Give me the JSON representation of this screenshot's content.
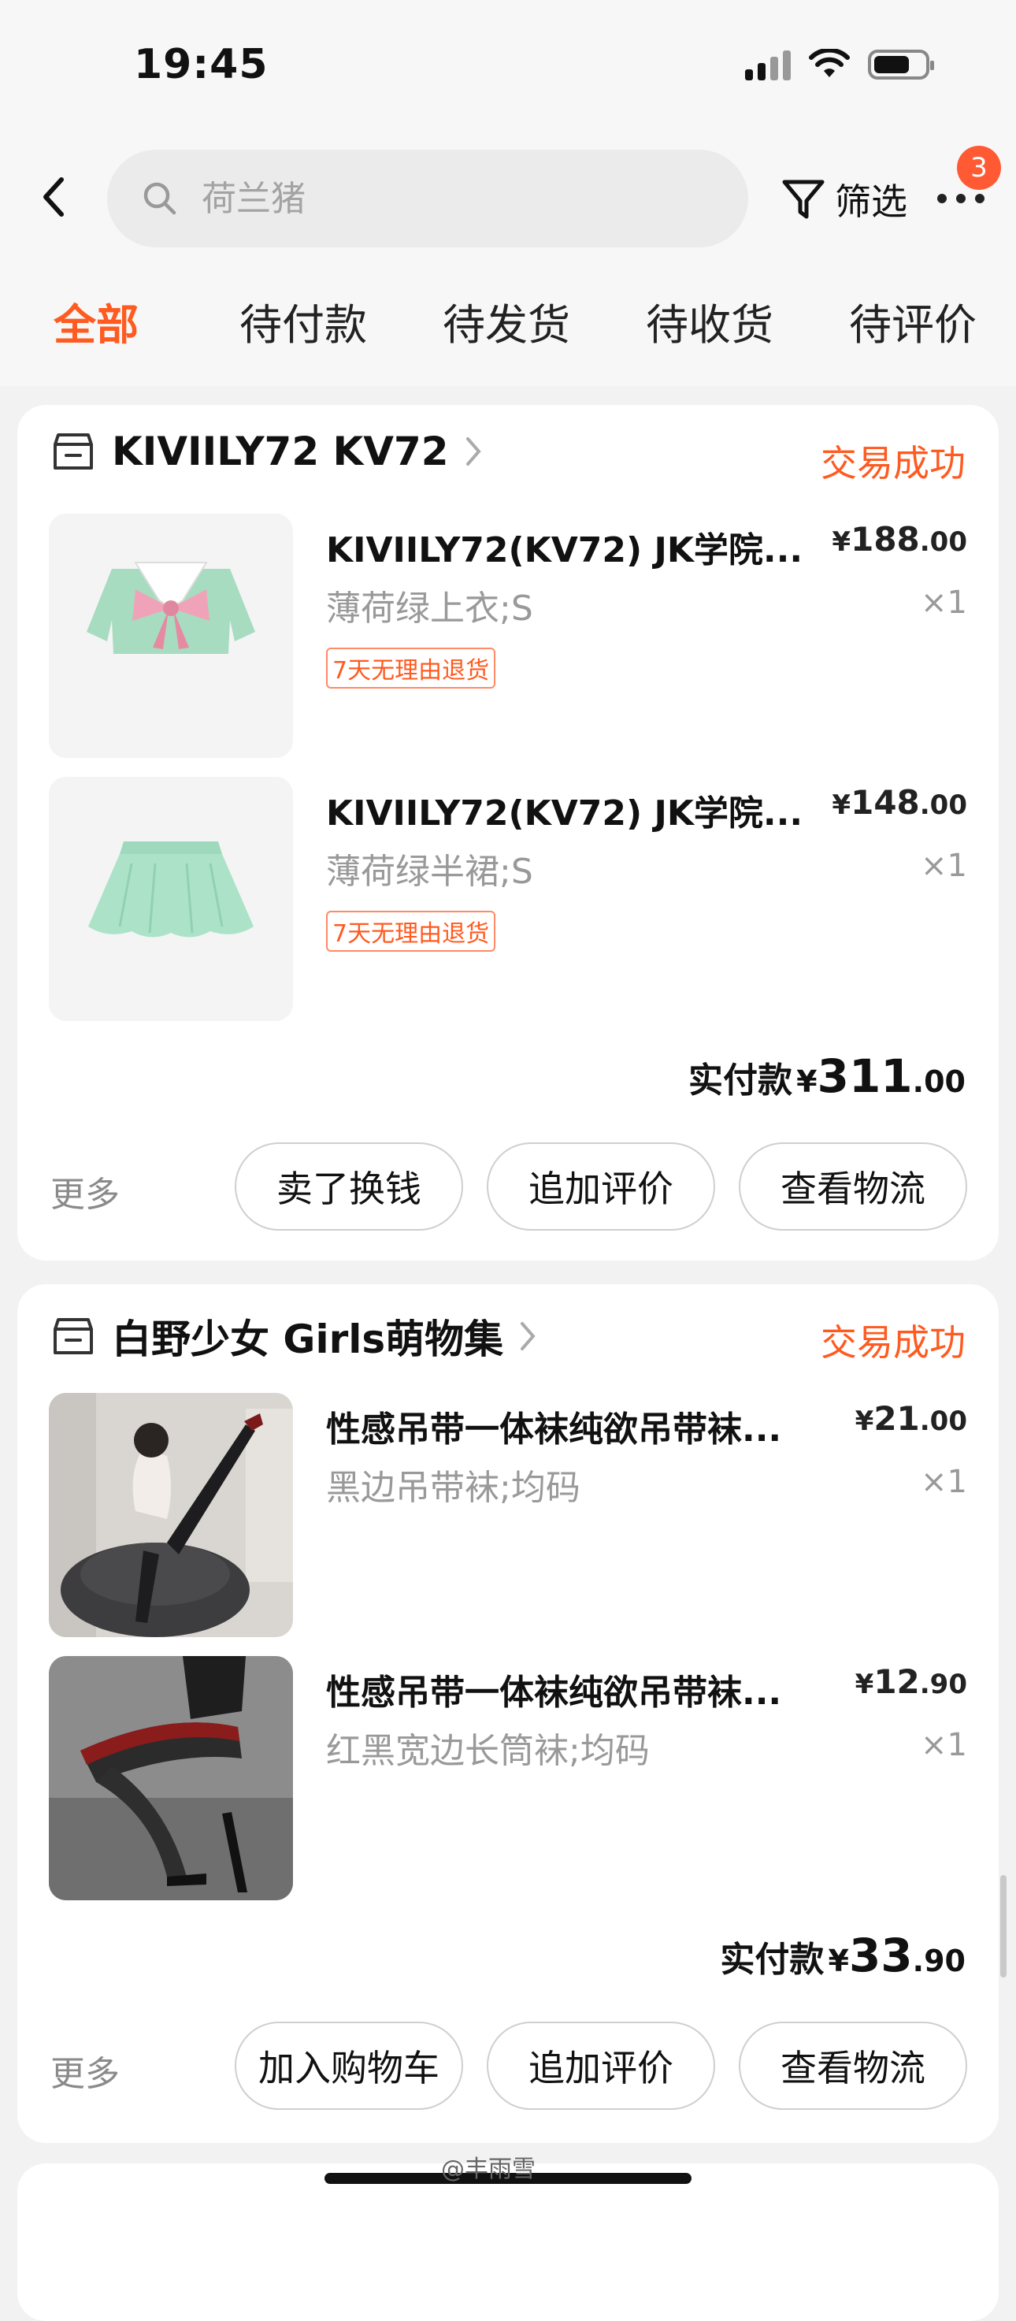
{
  "status_bar": {
    "time": "19:45"
  },
  "search": {
    "placeholder": "荷兰猪"
  },
  "header": {
    "filter_label": "筛选",
    "badge_count": "3"
  },
  "tabs": [
    {
      "label": "全部",
      "active": true
    },
    {
      "label": "待付款"
    },
    {
      "label": "待发货"
    },
    {
      "label": "待收货"
    },
    {
      "label": "待评价"
    }
  ],
  "orders": [
    {
      "shop": "KIVIILY72 KV72",
      "status": "交易成功",
      "items": [
        {
          "title": "KIVIILY72(KV72) JK学院...",
          "sku": "薄荷绿上衣;S",
          "price_cur": "¥",
          "price_int": "188",
          "price_dec": ".00",
          "qty": "×1",
          "tag": "7天无理由退货"
        },
        {
          "title": "KIVIILY72(KV72) JK学院...",
          "sku": "薄荷绿半裙;S",
          "price_cur": "¥",
          "price_int": "148",
          "price_dec": ".00",
          "qty": "×1",
          "tag": "7天无理由退货"
        }
      ],
      "total_label": "实付款",
      "total_cur": "¥",
      "total_int": "311",
      "total_dec": ".00",
      "more": "更多",
      "buttons": [
        "卖了换钱",
        "追加评价",
        "查看物流"
      ]
    },
    {
      "shop": "白野少女 Girls萌物集",
      "status": "交易成功",
      "items": [
        {
          "title": "性感吊带一体袜纯欲吊带袜...",
          "sku": "黑边吊带袜;均码",
          "price_cur": "¥",
          "price_int": "21",
          "price_dec": ".00",
          "qty": "×1"
        },
        {
          "title": "性感吊带一体袜纯欲吊带袜...",
          "sku": "红黑宽边长筒袜;均码",
          "price_cur": "¥",
          "price_int": "12",
          "price_dec": ".90",
          "qty": "×1"
        }
      ],
      "total_label": "实付款",
      "total_cur": "¥",
      "total_int": "33",
      "total_dec": ".90",
      "more": "更多",
      "buttons": [
        "加入购物车",
        "追加评价",
        "查看物流"
      ]
    }
  ],
  "watermark": "@丰雨雪",
  "colors": {
    "accent": "#ff5a1f",
    "background": "#f2f2f2"
  }
}
